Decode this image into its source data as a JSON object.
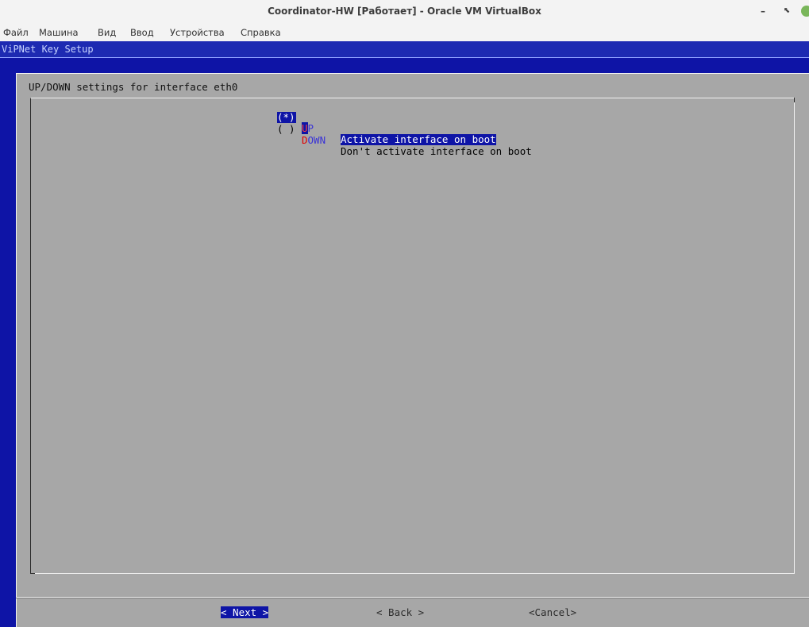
{
  "window": {
    "title": "Coordinator-HW [Работает] - Oracle VM VirtualBox",
    "minimize_glyph": "–",
    "maximize_glyph": "⬉"
  },
  "menubar": {
    "items": [
      "Файл",
      "Машина",
      "Вид",
      "Ввод",
      "Устройства",
      "Справка"
    ]
  },
  "vm": {
    "header_title": "ViPNet Key Setup",
    "dialog": {
      "title": "UP/DOWN settings for interface eth0",
      "options": [
        {
          "radio": "(*)",
          "hotkey": "U",
          "tag_rest": "P",
          "description": "Activate interface on boot",
          "selected": true
        },
        {
          "radio": "( )",
          "hotkey": "D",
          "tag_rest": "OWN",
          "description": "Don't activate interface on boot",
          "selected": false
        }
      ],
      "buttons": {
        "next": "< Next >",
        "back": "< Back >",
        "cancel": "<Cancel>"
      }
    }
  },
  "colors": {
    "vm_background": "#0e14a6",
    "dialog_background": "#a7a7a7",
    "highlight": "#0e14a6",
    "hotkey": "#e00000",
    "tag_text": "#3a33d6"
  }
}
